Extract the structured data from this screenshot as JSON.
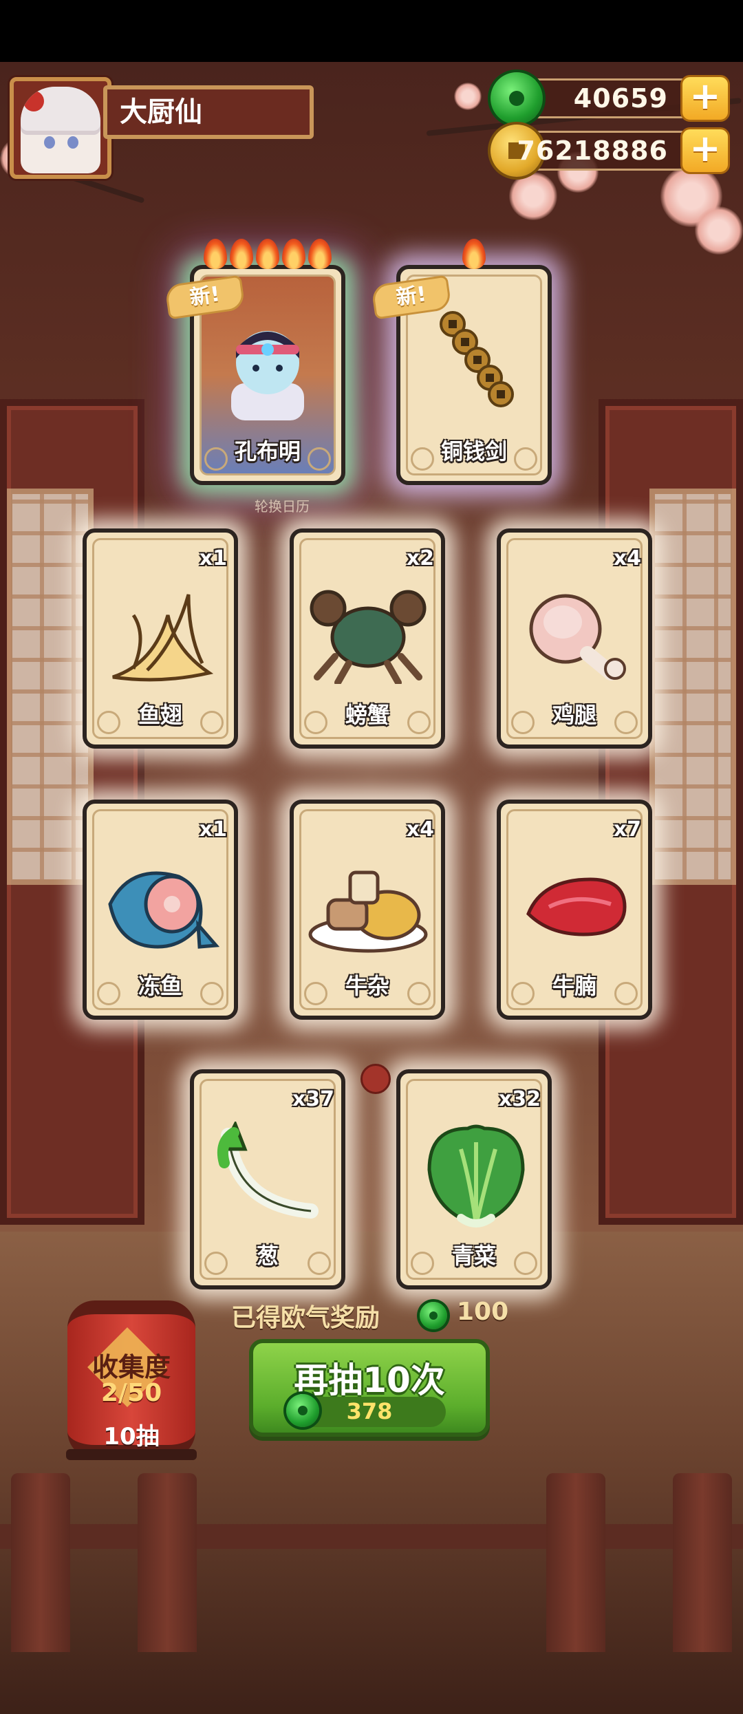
{
  "player": {
    "name": "大厨仙"
  },
  "currencies": [
    {
      "name": "jade",
      "value": "40659",
      "plus_label": "+"
    },
    {
      "name": "coin",
      "value": "76218886",
      "plus_label": "+"
    }
  ],
  "top_cards": [
    {
      "name": "孔布明",
      "badge": "新!",
      "stars": 5,
      "fill_stars": 5
    },
    {
      "name": "铜钱剑",
      "badge": "新!",
      "stars": 1,
      "fill_stars": 1
    }
  ],
  "subtitle": "轮换日历",
  "items": [
    {
      "name": "鱼翅",
      "count": "x1"
    },
    {
      "name": "螃蟹",
      "count": "x2"
    },
    {
      "name": "鸡腿",
      "count": "x4"
    },
    {
      "name": "冻鱼",
      "count": "x1"
    },
    {
      "name": "牛杂",
      "count": "x4"
    },
    {
      "name": "牛腩",
      "count": "x7"
    },
    {
      "name": "葱",
      "count": "x37"
    },
    {
      "name": "青菜",
      "count": "x32"
    }
  ],
  "reward": {
    "label": "已得欧气奖励",
    "value": "100"
  },
  "draw": {
    "label": "再抽10次",
    "cost": "378"
  },
  "collection": {
    "title": "收集度",
    "progress": "2/50",
    "note": "10抽"
  },
  "colors": {
    "accent_green": "#5cae2c",
    "card_bg": "#f3e1bd",
    "gold": "#f2a925"
  }
}
